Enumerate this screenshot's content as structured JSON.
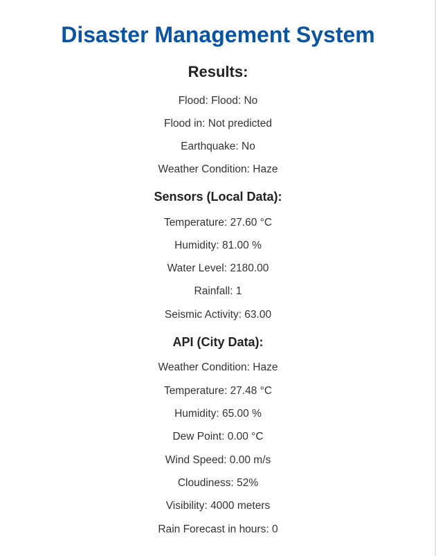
{
  "title": "Disaster Management System",
  "results": {
    "heading": "Results:",
    "items": [
      "Flood: Flood: No",
      "Flood in: Not predicted",
      "Earthquake: No",
      "Weather Condition: Haze"
    ]
  },
  "sensors": {
    "heading": "Sensors (Local Data):",
    "items": [
      "Temperature: 27.60 °C",
      "Humidity: 81.00 %",
      "Water Level: 2180.00",
      "Rainfall: 1",
      "Seismic Activity: 63.00"
    ]
  },
  "api": {
    "heading": "API (City Data):",
    "items": [
      "Weather Condition: Haze",
      "Temperature: 27.48 °C",
      "Humidity: 65.00 %",
      "Dew Point: 0.00 °C",
      "Wind Speed: 0.00 m/s",
      "Cloudiness: 52%",
      "Visibility: 4000 meters",
      "Rain Forecast in hours: 0"
    ]
  },
  "colors": {
    "title": "#0a54a3",
    "text": "#333333",
    "heading": "#222222"
  }
}
